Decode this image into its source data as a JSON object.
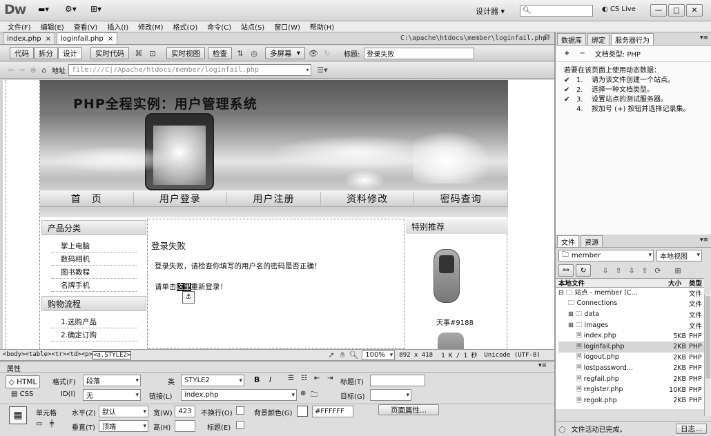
{
  "app": {
    "logo": "Dw",
    "workspace": "设计器",
    "search_placeholder": "",
    "cslive": "CS Live",
    "win": {
      "min": "—",
      "max": "□",
      "close": "✕"
    }
  },
  "menu": [
    "文件(F)",
    "编辑(E)",
    "查看(V)",
    "插入(I)",
    "修改(M)",
    "格式(O)",
    "命令(C)",
    "站点(S)",
    "窗口(W)",
    "帮助(H)"
  ],
  "doc_tabs": [
    {
      "label": "index.php"
    },
    {
      "label": "loginfail.php"
    }
  ],
  "doc_path": "C:\\apache\\htdocs\\member\\loginfail.php",
  "toolbar": {
    "code": "代码",
    "split": "拆分",
    "design": "设计",
    "live_code": "实时代码",
    "live_view": "实时视图",
    "inspect": "检查",
    "multiscreen": "多屏幕",
    "title_label": "标题:",
    "title_value": "登录失败"
  },
  "address": {
    "label": "地址",
    "value": "file:///C|/Apache/htdocs/member/loginfail.php"
  },
  "page": {
    "banner_title": "PHP全程实例：用户管理系统",
    "nav": [
      "首　页",
      "用户登录",
      "用户注册",
      "资料修改",
      "密码查询"
    ],
    "left_head1": "产品分类",
    "left_links1": [
      "掌上电脑",
      "数码相机",
      "图书教程",
      "名牌手机"
    ],
    "left_head2": "购物流程",
    "left_links2": [
      "1.选购产品",
      "2.确定订购"
    ],
    "content_title": "登录失败",
    "content_msg": "登录失败，请检查你填写的用户名的密码是否正确！",
    "content_retry_pre": "请单击",
    "content_retry_link": "这里",
    "content_retry_post": "重新登录！",
    "right_head": "特别推荐",
    "product_caption": "天事#9188"
  },
  "status": {
    "tags": [
      "<body>",
      "<table>",
      "<tr>",
      "<td>",
      "<p>",
      "<a.STYLE2>"
    ],
    "zoom": "100%",
    "size": "892 x 418",
    "filesize": "1 K / 1 秒",
    "encoding": "Unicode (UTF-8)"
  },
  "props": {
    "title": "属性",
    "html_btn": "HTML",
    "css_btn": "CSS",
    "format_label": "格式(F)",
    "format_value": "段落",
    "class_label": "类",
    "class_value": "STYLE2",
    "id_label": "ID(I)",
    "id_value": "无",
    "link_label": "链接(L)",
    "link_value": "index.php",
    "title_label": "标题(T)",
    "title_value": "",
    "target_label": "目标(G)",
    "target_value": "",
    "cell_label": "单元格",
    "horz_label": "水平(Z)",
    "horz_value": "默认",
    "vert_label": "垂直(T)",
    "vert_value": "顶端",
    "width_label": "宽(W)",
    "width_value": "423",
    "height_label": "高(H)",
    "height_value": "",
    "nowrap_label": "不换行(O)",
    "header_label": "标题(E)",
    "bg_label": "背景颜色(G)",
    "bg_value": "#FFFFFF",
    "page_props": "页面属性..."
  },
  "right_panel": {
    "tabs": [
      "数据库",
      "绑定",
      "服务器行为"
    ],
    "doctype": "文档类型: PHP",
    "intro": "若要在该页面上使用动态数据：",
    "steps": [
      {
        "n": "1.",
        "t": "请为该文件创建一个站点。"
      },
      {
        "n": "2.",
        "t": "选择一种文档类型。"
      },
      {
        "n": "3.",
        "t": "设置站点的测试服务器。"
      },
      {
        "n": "4.",
        "t": "按加号 (+) 按钮并选择记录集。"
      }
    ]
  },
  "files_panel": {
    "tabs": [
      "文件",
      "资源"
    ],
    "site": "member",
    "view": "本地视图",
    "cols": {
      "name": "本地文件",
      "size": "大小",
      "type": "类型"
    },
    "rows": [
      {
        "name": "站点 - member (C...",
        "size": "",
        "type": "文件",
        "lvl": 0
      },
      {
        "name": "Connections",
        "size": "",
        "type": "文件",
        "lvl": 1
      },
      {
        "name": "data",
        "size": "",
        "type": "文件",
        "lvl": 1
      },
      {
        "name": "images",
        "size": "",
        "type": "文件",
        "lvl": 1
      },
      {
        "name": "index.php",
        "size": "5KB",
        "type": "PHP",
        "lvl": 2
      },
      {
        "name": "loginfail.php",
        "size": "2KB",
        "type": "PHP",
        "lvl": 2
      },
      {
        "name": "logout.php",
        "size": "2KB",
        "type": "PHP",
        "lvl": 2
      },
      {
        "name": "lostpassword...",
        "size": "2KB",
        "type": "PHP",
        "lvl": 2
      },
      {
        "name": "regfail.php",
        "size": "2KB",
        "type": "PHP",
        "lvl": 2
      },
      {
        "name": "register.php",
        "size": "10KB",
        "type": "PHP",
        "lvl": 2
      },
      {
        "name": "regok.php",
        "size": "2KB",
        "type": "PHP",
        "lvl": 2
      }
    ],
    "status": "文件活动已完成。",
    "log_btn": "日志..."
  }
}
